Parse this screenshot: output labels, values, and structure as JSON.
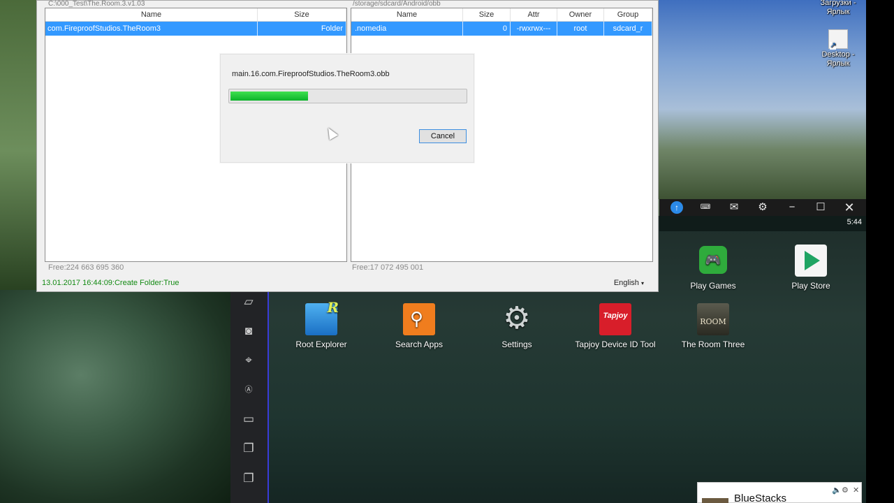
{
  "desktop": {
    "icons": [
      {
        "label": "Загрузки -\nЯрлык"
      },
      {
        "label": "Desktop -\nЯрлык"
      }
    ]
  },
  "file_manager": {
    "left_panel": {
      "path": "C:\\000_Test\\The.Room.3.v1.03",
      "columns": [
        "Name",
        "Size"
      ],
      "selected_row": {
        "name": "com.FireproofStudios.TheRoom3",
        "size": "Folder"
      },
      "free": "Free:224 663 695 360"
    },
    "right_panel": {
      "path": "/storage/sdcard/Android/obb",
      "columns": [
        "Name",
        "Size",
        "Attr",
        "Owner",
        "Group"
      ],
      "selected_row": {
        "name": ".nomedia",
        "size": "0",
        "attr": "-rwxrwx---",
        "owner": "root",
        "group": "sdcard_r"
      },
      "free": "Free:17 072 495 001"
    },
    "status_log": "13.01.2017 16:44:09:Create Folder:True",
    "language": "English"
  },
  "progress_dialog": {
    "filename": "main.16.com.FireproofStudios.TheRoom3.obb",
    "progress_fraction": 0.33,
    "cancel_label": "Cancel"
  },
  "bluestacks": {
    "clock": "5:44",
    "apps_top": [
      {
        "label": "Play Games",
        "icon": "play-games-icon"
      },
      {
        "label": "Play Store",
        "icon": "play-store-icon"
      }
    ],
    "apps": [
      {
        "label": "Root Explorer",
        "icon": "root-explorer-icon"
      },
      {
        "label": "Search Apps",
        "icon": "search-icon"
      },
      {
        "label": "Settings",
        "icon": "gear-icon"
      },
      {
        "label": "Tapjoy Device ID Tool",
        "icon": "tapjoy-icon"
      },
      {
        "label": "The Room Three",
        "icon": "the-room-icon"
      }
    ],
    "tapjoy_icon_text": "Tapjoy",
    "room_icon_text": "ROOM",
    "notification_title": "BlueStacks"
  },
  "colors": {
    "selection": "#3399ff",
    "progress": "#0bb32a",
    "status_text": "#138a13"
  }
}
